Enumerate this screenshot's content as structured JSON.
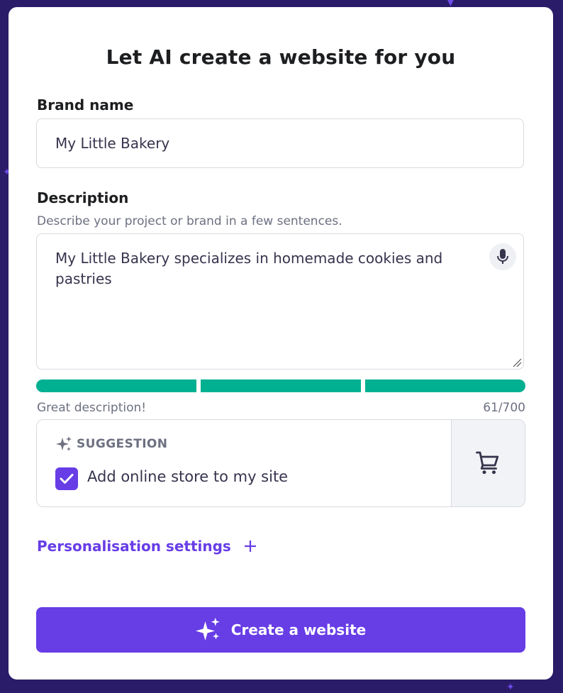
{
  "dialog": {
    "title": "Let AI create a website for you"
  },
  "brand": {
    "label": "Brand name",
    "value": "My Little Bakery"
  },
  "description": {
    "label": "Description",
    "hint": "Describe your project or brand in a few sentences.",
    "value": "My Little Bakery specializes in homemade cookies and pastries",
    "quality_text": "Great description!",
    "counter": "61/700",
    "strength_segments_filled": 3,
    "strength_segments_total": 3
  },
  "suggestion": {
    "heading": "SUGGESTION",
    "checkbox_label": "Add online store to my site",
    "checked": true
  },
  "personalisation": {
    "label": "Personalisation settings"
  },
  "cta": {
    "label": "Create a website"
  },
  "colors": {
    "accent": "#673de6",
    "strength": "#00b090",
    "background": "#2a1c68"
  },
  "icons": {
    "mic": "microphone-icon",
    "sparkle": "sparkle-icon",
    "check": "check-icon",
    "cart": "shopping-cart-icon",
    "plus": "plus-icon"
  }
}
